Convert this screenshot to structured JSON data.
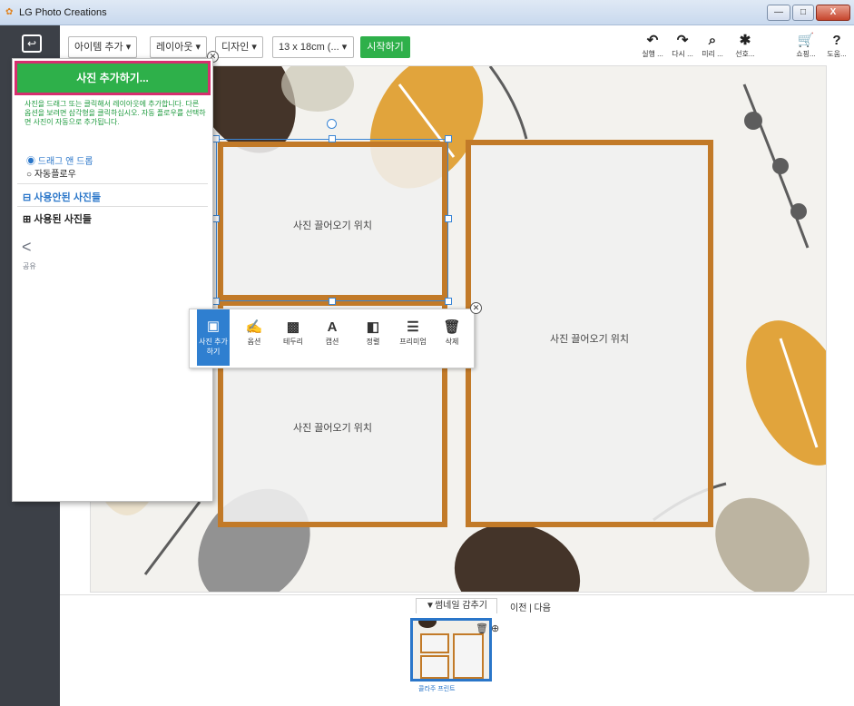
{
  "window": {
    "title": "LG Photo Creations",
    "min_label": "—",
    "max_label": "□",
    "close_label": "X"
  },
  "leftbar": {
    "back_label": "↩"
  },
  "toolbar": {
    "add_item": "아이템 추가 ▾",
    "layout": "레이아웃 ▾",
    "design": "디자인 ▾",
    "size": "13 x 18cm (... ▾",
    "start": "시작하기",
    "tools": [
      {
        "label": "실행 ...",
        "icon": "↶"
      },
      {
        "label": "다시 ...",
        "icon": "↷"
      },
      {
        "label": "미리 ...",
        "icon": "⌕"
      },
      {
        "label": "선호...",
        "icon": "✱"
      },
      {
        "label": "쇼핑...",
        "icon": "🛒"
      },
      {
        "label": "도움...",
        "icon": "?"
      }
    ]
  },
  "panel": {
    "add_photos": "사진 추가하기...",
    "description": "사진을 드래그 또는 클릭해서 레이아웃에 추가합니다. 다른 옵션을 보려면 삼각형을 클릭하십시오. 자동 플로우를 선택하면 사진이 자동으로 추가됩니다.",
    "radio_drag": "드래그 앤 드롭",
    "radio_auto": "자동플로우",
    "unused_photos": "사용안된 사진들",
    "used_photos": "사용된 사진들",
    "share": "공유"
  },
  "canvas": {
    "slot1": "사진 끌어오기 위치",
    "slot2": "사진 끌어오기 위치",
    "slot3": "사진 끌어오기 위치"
  },
  "context": {
    "active": "사진 추가하기",
    "items": [
      "옵션",
      "테두리",
      "캡션",
      "정렬",
      "프리미엄",
      "삭제"
    ]
  },
  "bottom": {
    "hide_thumbs": "▼썸네일 감추기",
    "prev_next": "이전 | 다음",
    "thumb_caption": "콜라주 프린트"
  },
  "colors": {
    "accent_green": "#2eb04a",
    "frame": "#c27a28",
    "select_blue": "#3a86d6"
  }
}
